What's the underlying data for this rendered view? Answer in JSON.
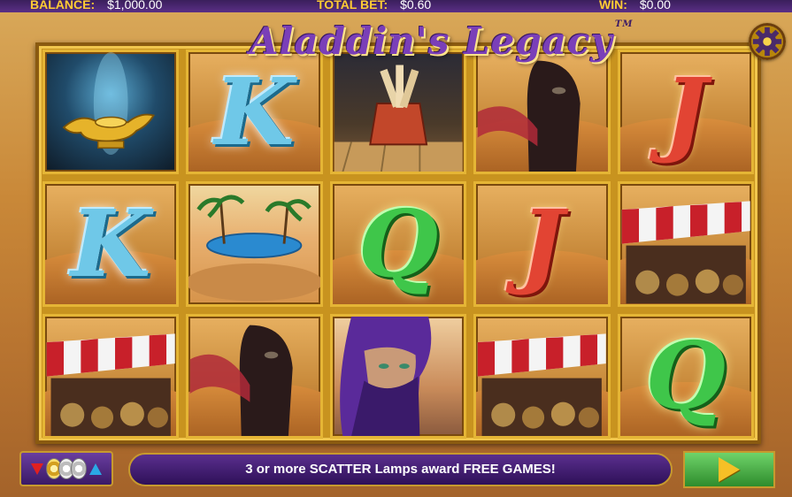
{
  "status": {
    "balance_label": "BALANCE:",
    "balance_value": "$1,000.00",
    "total_bet_label": "TOTAL BET:",
    "total_bet_value": "$0.60",
    "win_label": "WIN:",
    "win_value": "$0.00"
  },
  "title": {
    "text": "Aladdin's Legacy",
    "tm": "TM"
  },
  "reels": [
    [
      {
        "symbol": "lamp",
        "text": ""
      },
      {
        "symbol": "K",
        "text": "K"
      },
      {
        "symbol": "scrolls",
        "text": ""
      },
      {
        "symbol": "camel",
        "text": ""
      },
      {
        "symbol": "J",
        "text": "J"
      }
    ],
    [
      {
        "symbol": "K",
        "text": "K"
      },
      {
        "symbol": "oasis",
        "text": ""
      },
      {
        "symbol": "Q",
        "text": "Q"
      },
      {
        "symbol": "J",
        "text": "J"
      },
      {
        "symbol": "market",
        "text": ""
      }
    ],
    [
      {
        "symbol": "market",
        "text": ""
      },
      {
        "symbol": "camel",
        "text": ""
      },
      {
        "symbol": "aladdin",
        "text": ""
      },
      {
        "symbol": "market",
        "text": ""
      },
      {
        "symbol": "Q",
        "text": "Q"
      }
    ]
  ],
  "message": "3 or more SCATTER Lamps award FREE GAMES!",
  "icons": {
    "settings": "gear-icon",
    "bet": "bet-adjust-icon",
    "spin": "play-icon"
  },
  "colors": {
    "topbar": "#3a1f5c",
    "gold": "#f1c64d",
    "message_bar": "#5a2f8e",
    "spin": "#2e8c2c"
  }
}
